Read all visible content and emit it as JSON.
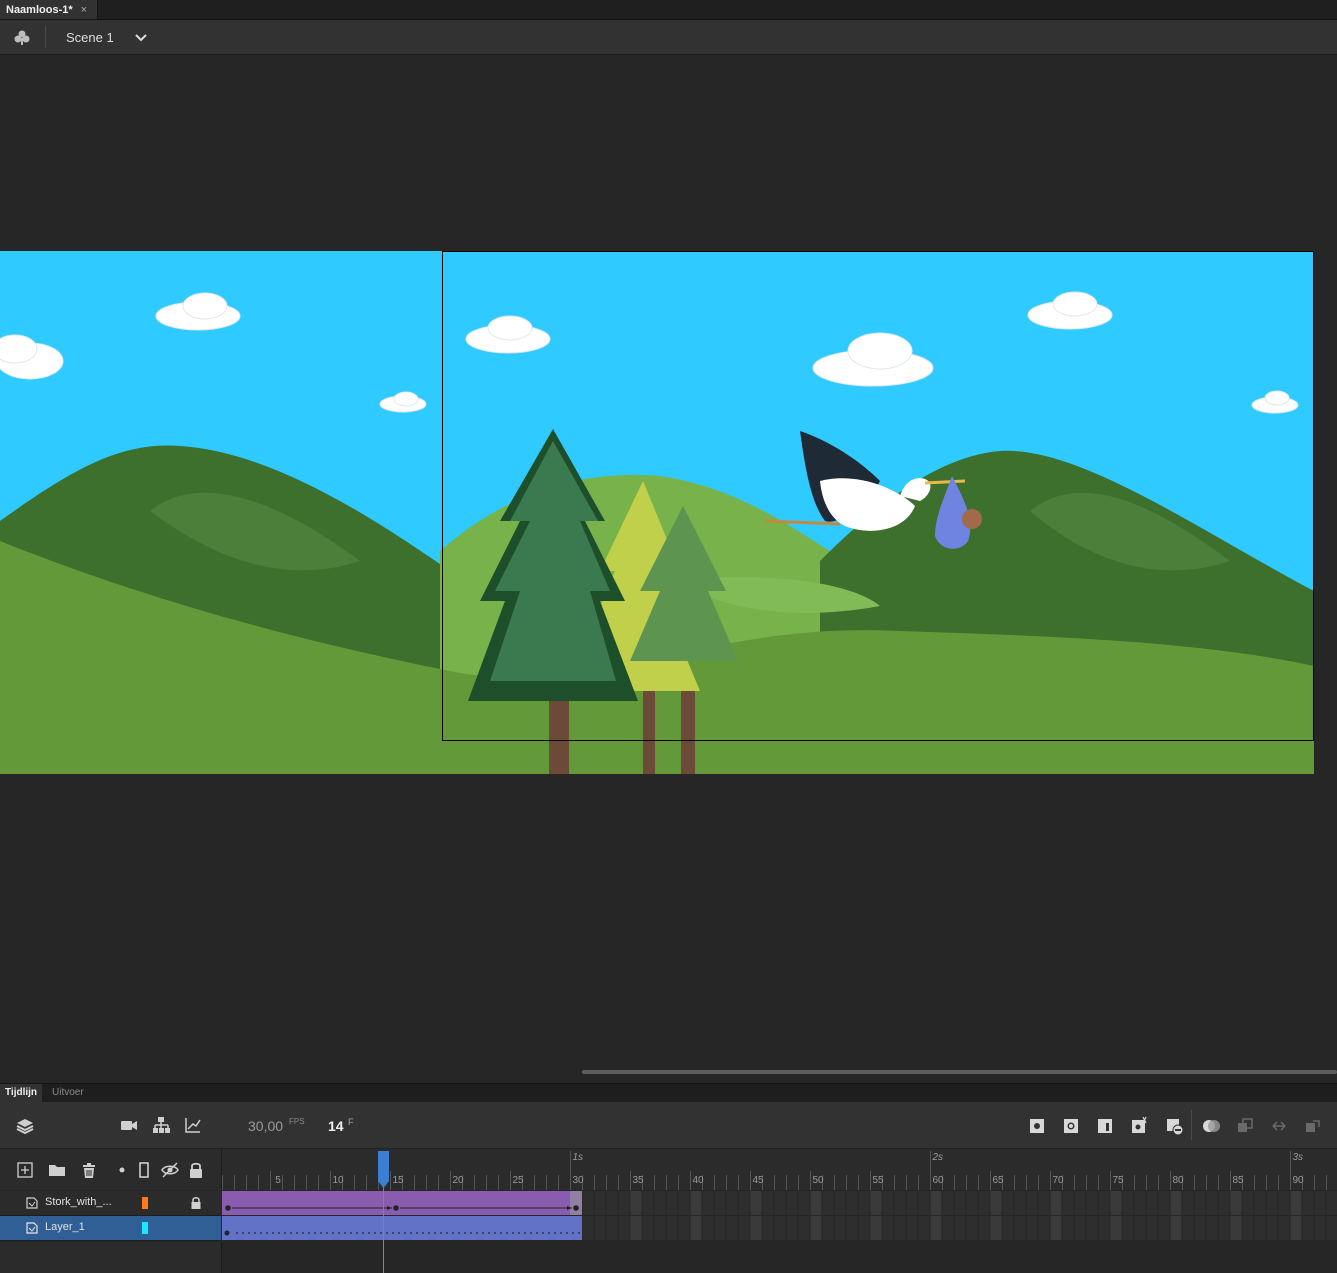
{
  "document": {
    "tab_title": "Naamloos-1*",
    "close_glyph": "×"
  },
  "editbar": {
    "scene_icon": "scene-clubs-icon",
    "scene_label": "Scene 1",
    "dropdown_icon": "chevron-down-icon"
  },
  "panel_tabs": {
    "timeline": "Tijdlijn",
    "output": "Uitvoer"
  },
  "timeline": {
    "fps": "30,00",
    "fps_unit": "FPS",
    "current_frame": "14",
    "frame_unit": "F",
    "playhead_frame": 14,
    "ruler": {
      "frame_labels": [
        "5",
        "10",
        "15",
        "20",
        "25",
        "30",
        "35",
        "40",
        "45",
        "50",
        "55",
        "60",
        "65",
        "70",
        "75",
        "80",
        "85",
        "90"
      ],
      "second_labels": [
        "1s",
        "2s",
        "3s"
      ]
    },
    "layers": [
      {
        "name": "Stork_with_...",
        "color": "#ff7a1a",
        "locked": true,
        "selected": false,
        "tween_start": 1,
        "tween_end": 30,
        "keyframes": [
          1,
          15,
          30
        ]
      },
      {
        "name": "Layer_1",
        "color": "#19e6ff",
        "locked": false,
        "selected": true,
        "tween_start": 1,
        "tween_end": 30,
        "keyframes": [
          1
        ]
      }
    ],
    "toolbar_left_icons": [
      "layers-icon",
      "camera-icon",
      "layer-parenting-icon",
      "graph-icon"
    ],
    "toolbar_right_icons": [
      "insert-keyframe-icon",
      "insert-blank-keyframe-icon",
      "insert-frame-icon",
      "create-tween-icon",
      "remove-frame-icon",
      "onion-skin-icon",
      "edit-multiple-frames-icon",
      "loop-icon",
      "sync-icon"
    ],
    "layer_header_icons": [
      "new-layer-icon",
      "new-folder-icon",
      "delete-icon",
      "highlight-dot-icon",
      "outline-icon",
      "show-hide-icon",
      "lock-icon"
    ]
  },
  "colors": {
    "sky": "#2fcaff",
    "hill_dark": "#3d6f2d",
    "hill_light": "#77b34a",
    "ground": "#64993a",
    "tween_purple": "#8a5cb0",
    "tween_blue": "#6272c6",
    "selection_blue": "#2f5f94",
    "playhead": "#4a8fe0"
  }
}
